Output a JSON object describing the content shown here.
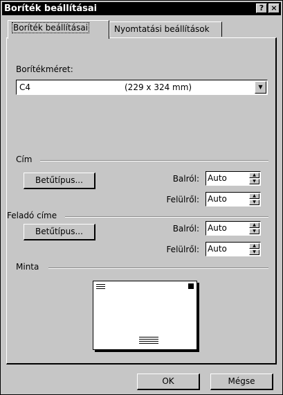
{
  "window": {
    "title": "Boríték beállításai",
    "help_label": "?",
    "close_label": "×"
  },
  "tabs": [
    {
      "label": "Boríték beállításai"
    },
    {
      "label": "Nyomtatási beállítások"
    }
  ],
  "envelope_size": {
    "label": "Borítékméret:",
    "selected_name": "C4",
    "selected_dimensions": "(229 x 324 mm)"
  },
  "address": {
    "section_label": "Cím",
    "font_button": "Betűtípus...",
    "left_label": "Balról:",
    "left_value": "Auto",
    "top_label": "Felülről:",
    "top_value": "Auto"
  },
  "return_address": {
    "section_label": "Feladó címe",
    "font_button": "Betűtípus...",
    "left_label": "Balról:",
    "left_value": "Auto",
    "top_label": "Felülről:",
    "top_value": "Auto"
  },
  "preview": {
    "section_label": "Minta"
  },
  "footer": {
    "ok_label": "OK",
    "cancel_label": "Mégse"
  }
}
